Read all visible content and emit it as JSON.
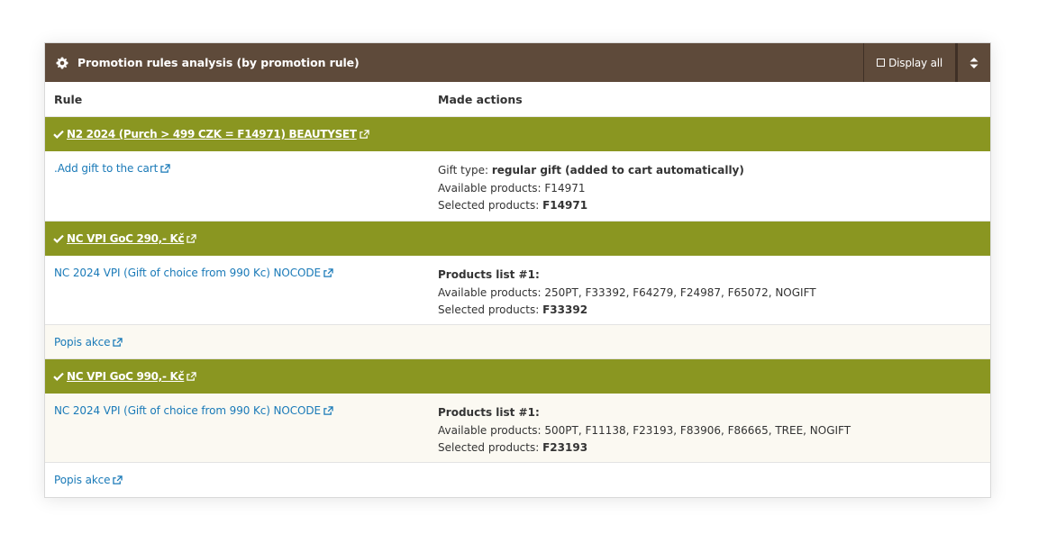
{
  "header": {
    "title": "Promotion rules analysis (by promotion rule)",
    "display_all_label": "Display all"
  },
  "columns": {
    "rule": "Rule",
    "made_actions": "Made actions"
  },
  "groups": [
    {
      "title": "N2 2024 (Purch > 499 CZK = F14971) BEAUTYSET",
      "rows": [
        {
          "rule_link": ".Add gift to the cart",
          "gift_type_label": "Gift type: ",
          "gift_type_value": "regular gift (added to cart automatically)",
          "available_label": "Available products: ",
          "available_value": "F14971",
          "selected_label": "Selected products: ",
          "selected_value": "F14971"
        }
      ]
    },
    {
      "title": "NC VPI GoC 290,- Kč",
      "rows": [
        {
          "rule_link": "NC 2024 VPI (Gift of choice from 990 Kc) NOCODE",
          "list_title": "Products list #1:",
          "available_label": "Available products: ",
          "available_value": "250PT, F33392, F64279, F24987, F65072, NOGIFT",
          "selected_label": "Selected products: ",
          "selected_value": "F33392"
        }
      ],
      "footer_link": "Popis akce"
    },
    {
      "title": "NC VPI GoC 990,- Kč",
      "rows": [
        {
          "rule_link": "NC 2024 VPI (Gift of choice from 990 Kc) NOCODE",
          "list_title": "Products list #1:",
          "available_label": "Available products: ",
          "available_value": "500PT, F11138, F23193, F83906, F86665, TREE, NOGIFT",
          "selected_label": "Selected products: ",
          "selected_value": "F23193"
        }
      ],
      "footer_link": "Popis akce"
    }
  ],
  "colors": {
    "header_bg": "#5e4a3a",
    "group_bg": "#8a9621",
    "link": "#1a7ab8"
  }
}
